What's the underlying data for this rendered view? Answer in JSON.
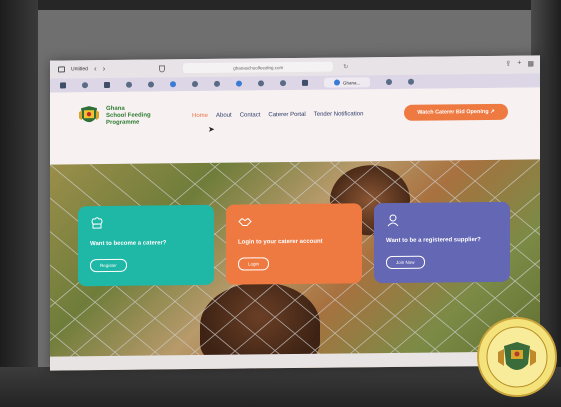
{
  "browser": {
    "tab_title": "Untitled",
    "url": "ghanaschoolfeeding.com",
    "active_tab_label": "Ghana..."
  },
  "site": {
    "brand_line1": "Ghana",
    "brand_line2": "School Feeding",
    "brand_line3": "Programme",
    "nav": [
      "Home",
      "About",
      "Contact",
      "Caterer Portal",
      "Tender Notification"
    ],
    "active_nav": "Home",
    "cta_label": "Watch Caterer Bid Opening"
  },
  "cards": [
    {
      "title": "Want to become a caterer?",
      "button": "Register",
      "color": "#1fb7a6"
    },
    {
      "title": "Login to your caterer account",
      "button": "Login",
      "color": "#ee7a42"
    },
    {
      "title": "Want to be a registered supplier?",
      "button": "Join Now",
      "color": "#6467b3"
    }
  ],
  "colors": {
    "accent": "#ee7a42",
    "brand_green": "#2e7d32",
    "nav_blue": "#2b3a67"
  },
  "icons": [
    "sidebar-icon",
    "shield-icon",
    "share-icon",
    "plus-icon",
    "tabs-icon",
    "chef-icon",
    "handshake-icon",
    "supplier-icon",
    "coat-of-arms-icon"
  ]
}
